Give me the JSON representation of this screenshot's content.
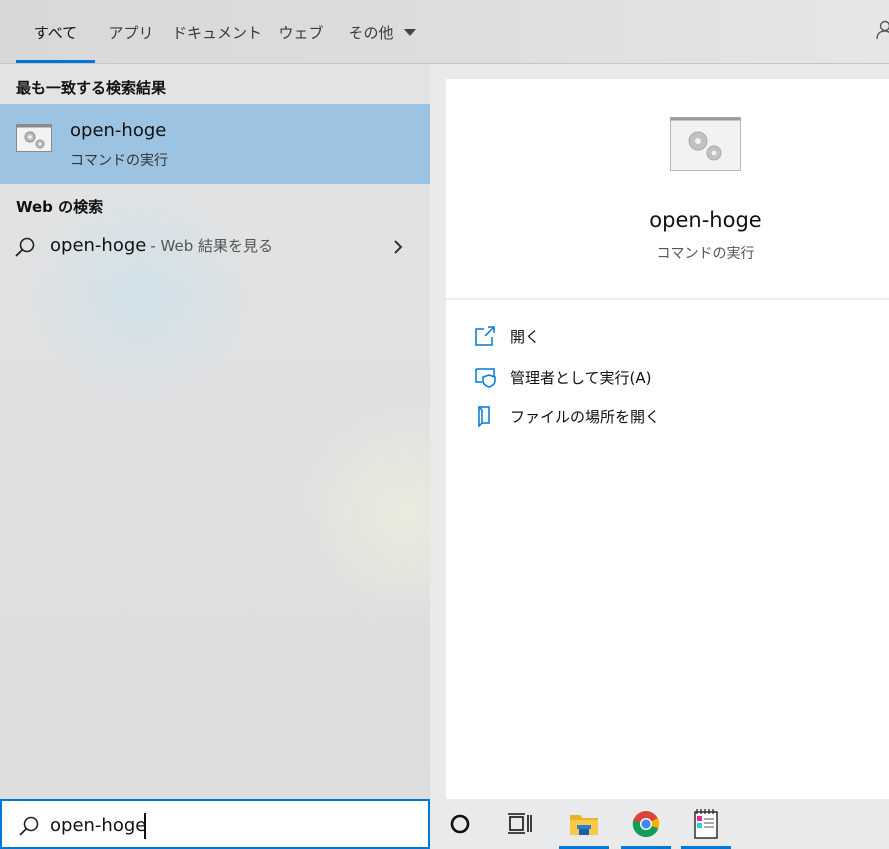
{
  "tabs": [
    {
      "label": "すべて"
    },
    {
      "label": "アプリ"
    },
    {
      "label": "ドキュメント"
    },
    {
      "label": "ウェブ"
    },
    {
      "label": "その他"
    }
  ],
  "results": {
    "best_match_header": "最も一致する検索結果",
    "best_match": {
      "name": "open-hoge",
      "type": "コマンドの実行",
      "icon": "command-gear-icon"
    },
    "web_header": "Web の検索",
    "web_result": {
      "query": "open-hoge",
      "hint": "- Web 結果を見る"
    }
  },
  "preview": {
    "name": "open-hoge",
    "type": "コマンドの実行",
    "actions": [
      {
        "label": "開く",
        "icon": "open-icon"
      },
      {
        "label": "管理者として実行(A)",
        "icon": "run-as-admin-icon"
      },
      {
        "label": "ファイルの場所を開く",
        "icon": "file-location-icon"
      }
    ]
  },
  "search": {
    "value": "open-hoge"
  },
  "taskbar": {
    "items": [
      {
        "icon": "cortana-icon"
      },
      {
        "icon": "task-view-icon"
      },
      {
        "icon": "file-explorer-icon"
      },
      {
        "icon": "chrome-icon"
      },
      {
        "icon": "notepad-icon"
      }
    ]
  },
  "colors": {
    "accent": "#0078d7",
    "selected": "#9cc3e1"
  }
}
